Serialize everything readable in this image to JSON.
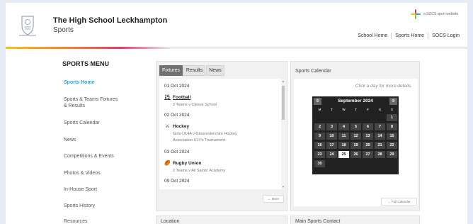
{
  "header": {
    "school_name": "The High School Leckhampton",
    "subtitle": "Sports",
    "socs_badge": "a SOCS sport website",
    "nav": [
      "School Home",
      "Sports Home",
      "SOCS Login"
    ]
  },
  "sidebar": {
    "title": "SPORTS MENU",
    "items": [
      {
        "label": "Sports Home",
        "active": true
      },
      {
        "label": "Sports & Teams Fixtures & Results",
        "active": false
      },
      {
        "label": "Sports Calendar",
        "active": false
      },
      {
        "label": "News",
        "active": false
      },
      {
        "label": "Competitions & Events",
        "active": false
      },
      {
        "label": "Photos & Videos",
        "active": false
      },
      {
        "label": "In-House Sport",
        "active": false
      },
      {
        "label": "Sports History",
        "active": false
      },
      {
        "label": "Resources",
        "active": false
      }
    ]
  },
  "fixtures": {
    "tabs": [
      "Fixtures",
      "Results",
      "News"
    ],
    "active_tab": "Fixtures",
    "dates": [
      "01 Oct 2024",
      "02 Oct 2024",
      "03 Oct 2024",
      "09 Oct 2024"
    ],
    "entries": [
      {
        "sport": "Football",
        "icon": "football-icon",
        "detail_1": "2 Teams v Cleeve School",
        "detail_2": ""
      },
      {
        "sport": "Hockey",
        "icon": "hockey-sticks-icon",
        "detail_1": "Girls-U14A v Gloucestershire Hockey",
        "detail_2": "Association U14's Tournament"
      },
      {
        "sport": "Rugby Union",
        "icon": "rugby-ball-icon",
        "detail_1": "2 Teams v All Saints' Academy",
        "detail_2": ""
      }
    ],
    "more_button": "← More"
  },
  "calendar": {
    "title": "Sports Calendar",
    "hint": "Click a day for more details.",
    "month": "September 2024",
    "weekdays": [
      "M",
      "T",
      "W",
      "T",
      "F",
      "S",
      "S"
    ],
    "prev_icon": "gear-icon",
    "next_icon": "gear-icon",
    "today": 25,
    "full_button": "← Full Calendar"
  },
  "location": {
    "title": "Location"
  },
  "contact": {
    "title": "Main Sports Contact"
  },
  "colors": {
    "accent_blue": "#2aa3d6",
    "stripe": [
      "#f3c21b",
      "#ed8a2c",
      "#e13a6a"
    ],
    "calendar_bg": "#222222",
    "tab_active": "#707070"
  }
}
